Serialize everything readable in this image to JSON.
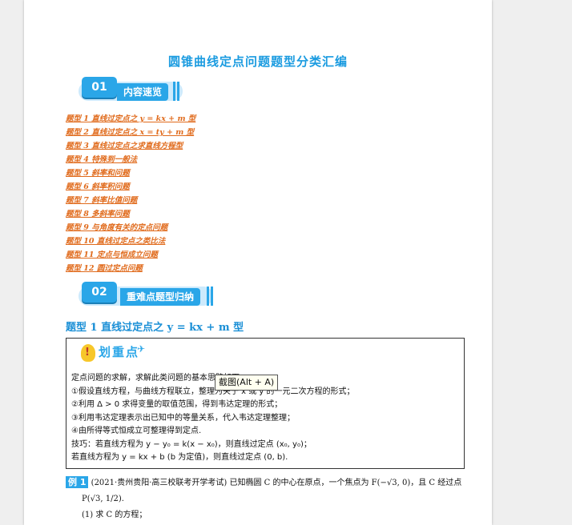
{
  "document": {
    "title": "圆锥曲线定点问题题型分类汇编"
  },
  "sections": [
    {
      "number": "01",
      "label": "内容速览"
    },
    {
      "number": "02",
      "label": "重难点题型归纳"
    }
  ],
  "toc": [
    "题型 1 直线过定点之 y = kx + m 型",
    "题型 2 直线过定点之 x = ty + m 型",
    "题型 3 直线过定点之求直线方程型",
    "题型 4 特殊到一般法",
    "题型 5 斜率和问题",
    "题型 6 斜率积问题",
    "题型 7 斜率比值问题",
    "题型 8 多斜率问题",
    "题型 9 与角度有关的定点问题",
    "题型 10 直线过定点之类比法",
    "题型 11 定点与恒成立问题",
    "题型 12 圆过定点问题"
  ],
  "section_title": "题型 1 直线过定点之 y = kx + m 型",
  "keypoint": {
    "heading": "划重点",
    "lines": [
      "定点问题的求解，求解此类问题的基本思路如下：",
      "①假设直线方程，与曲线方程联立，整理为关于 x 或 y 的一元二次方程的形式；",
      "②利用 Δ > 0 求得变量的取值范围，得到韦达定理的形式；",
      "③利用韦达定理表示出已知中的等量关系，代入韦达定理整理；",
      "④由所得等式恒成立可整理得到定点.",
      "技巧：若直线方程为 y − y₀ = k(x − x₀)，则直线过定点 (x₀, y₀)；",
      "若直线方程为 y = kx + b (b 为定值)，则直线过定点 (0, b)."
    ]
  },
  "tooltip": "截图(Alt + A)",
  "example": {
    "badge": "例 1",
    "line1": "(2021·贵州贵阳·高三校联考开学考试) 已知椭圆 C 的中心在原点，一个焦点为 F(−√3, 0)，且 C 经过点",
    "line2": "P(√3, 1/2).",
    "line3": "(1) 求 C 的方程；"
  },
  "colors": {
    "accent": "#2aa6e8",
    "toc_link": "#e06a1b",
    "title": "#1a9be0"
  }
}
